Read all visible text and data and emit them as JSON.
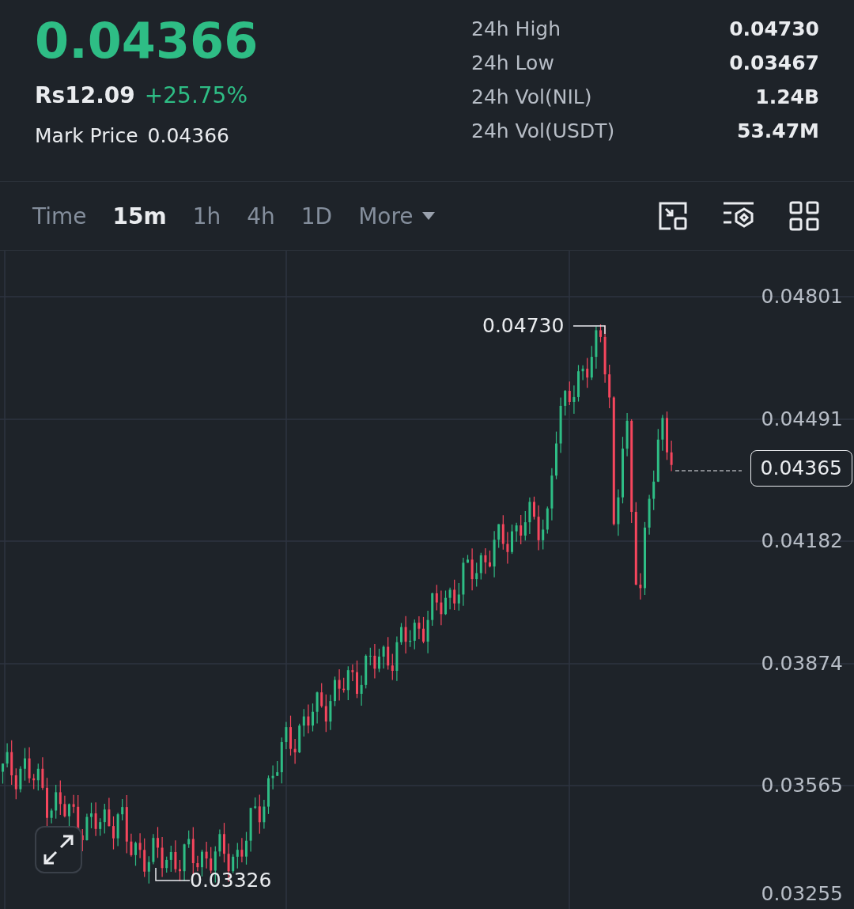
{
  "ticker": {
    "last_price": "0.04366",
    "fiat_price": "Rs12.09",
    "change": "+25.75%",
    "mark_price_label": "Mark Price",
    "mark_price": "0.04366"
  },
  "stats": [
    {
      "label": "24h High",
      "value": "0.04730"
    },
    {
      "label": "24h Low",
      "value": "0.03467"
    },
    {
      "label": "24h Vol(NIL)",
      "value": "1.24B"
    },
    {
      "label": "24h Vol(USDT)",
      "value": "53.47M"
    }
  ],
  "intervals": [
    {
      "label": "Time",
      "selected": false
    },
    {
      "label": "15m",
      "selected": true
    },
    {
      "label": "1h",
      "selected": false
    },
    {
      "label": "4h",
      "selected": false
    },
    {
      "label": "1D",
      "selected": false
    }
  ],
  "more_menu": {
    "label": "More"
  },
  "chart": {
    "price_axis": [
      "0.04801",
      "0.04491",
      "0.04182",
      "0.03874",
      "0.03565",
      "0.03255"
    ],
    "current_price": "0.04365",
    "high_marker": "0.04730",
    "low_marker": "0.03326"
  }
}
